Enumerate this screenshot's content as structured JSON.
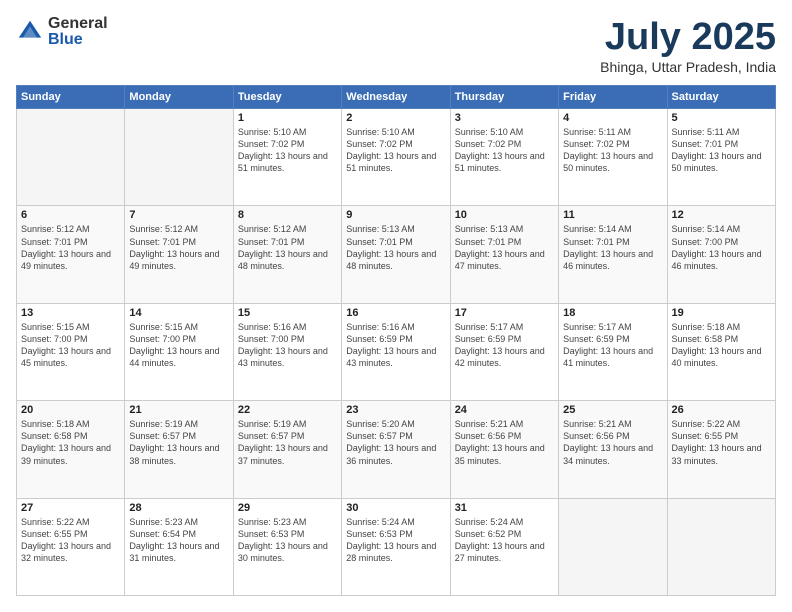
{
  "header": {
    "logo_general": "General",
    "logo_blue": "Blue",
    "month_title": "July 2025",
    "location": "Bhinga, Uttar Pradesh, India"
  },
  "days_of_week": [
    "Sunday",
    "Monday",
    "Tuesday",
    "Wednesday",
    "Thursday",
    "Friday",
    "Saturday"
  ],
  "weeks": [
    [
      {
        "day": "",
        "empty": true
      },
      {
        "day": "",
        "empty": true
      },
      {
        "day": "1",
        "sunrise": "5:10 AM",
        "sunset": "7:02 PM",
        "daylight": "13 hours and 51 minutes."
      },
      {
        "day": "2",
        "sunrise": "5:10 AM",
        "sunset": "7:02 PM",
        "daylight": "13 hours and 51 minutes."
      },
      {
        "day": "3",
        "sunrise": "5:10 AM",
        "sunset": "7:02 PM",
        "daylight": "13 hours and 51 minutes."
      },
      {
        "day": "4",
        "sunrise": "5:11 AM",
        "sunset": "7:02 PM",
        "daylight": "13 hours and 50 minutes."
      },
      {
        "day": "5",
        "sunrise": "5:11 AM",
        "sunset": "7:01 PM",
        "daylight": "13 hours and 50 minutes."
      }
    ],
    [
      {
        "day": "6",
        "sunrise": "5:12 AM",
        "sunset": "7:01 PM",
        "daylight": "13 hours and 49 minutes."
      },
      {
        "day": "7",
        "sunrise": "5:12 AM",
        "sunset": "7:01 PM",
        "daylight": "13 hours and 49 minutes."
      },
      {
        "day": "8",
        "sunrise": "5:12 AM",
        "sunset": "7:01 PM",
        "daylight": "13 hours and 48 minutes."
      },
      {
        "day": "9",
        "sunrise": "5:13 AM",
        "sunset": "7:01 PM",
        "daylight": "13 hours and 48 minutes."
      },
      {
        "day": "10",
        "sunrise": "5:13 AM",
        "sunset": "7:01 PM",
        "daylight": "13 hours and 47 minutes."
      },
      {
        "day": "11",
        "sunrise": "5:14 AM",
        "sunset": "7:01 PM",
        "daylight": "13 hours and 46 minutes."
      },
      {
        "day": "12",
        "sunrise": "5:14 AM",
        "sunset": "7:00 PM",
        "daylight": "13 hours and 46 minutes."
      }
    ],
    [
      {
        "day": "13",
        "sunrise": "5:15 AM",
        "sunset": "7:00 PM",
        "daylight": "13 hours and 45 minutes."
      },
      {
        "day": "14",
        "sunrise": "5:15 AM",
        "sunset": "7:00 PM",
        "daylight": "13 hours and 44 minutes."
      },
      {
        "day": "15",
        "sunrise": "5:16 AM",
        "sunset": "7:00 PM",
        "daylight": "13 hours and 43 minutes."
      },
      {
        "day": "16",
        "sunrise": "5:16 AM",
        "sunset": "6:59 PM",
        "daylight": "13 hours and 43 minutes."
      },
      {
        "day": "17",
        "sunrise": "5:17 AM",
        "sunset": "6:59 PM",
        "daylight": "13 hours and 42 minutes."
      },
      {
        "day": "18",
        "sunrise": "5:17 AM",
        "sunset": "6:59 PM",
        "daylight": "13 hours and 41 minutes."
      },
      {
        "day": "19",
        "sunrise": "5:18 AM",
        "sunset": "6:58 PM",
        "daylight": "13 hours and 40 minutes."
      }
    ],
    [
      {
        "day": "20",
        "sunrise": "5:18 AM",
        "sunset": "6:58 PM",
        "daylight": "13 hours and 39 minutes."
      },
      {
        "day": "21",
        "sunrise": "5:19 AM",
        "sunset": "6:57 PM",
        "daylight": "13 hours and 38 minutes."
      },
      {
        "day": "22",
        "sunrise": "5:19 AM",
        "sunset": "6:57 PM",
        "daylight": "13 hours and 37 minutes."
      },
      {
        "day": "23",
        "sunrise": "5:20 AM",
        "sunset": "6:57 PM",
        "daylight": "13 hours and 36 minutes."
      },
      {
        "day": "24",
        "sunrise": "5:21 AM",
        "sunset": "6:56 PM",
        "daylight": "13 hours and 35 minutes."
      },
      {
        "day": "25",
        "sunrise": "5:21 AM",
        "sunset": "6:56 PM",
        "daylight": "13 hours and 34 minutes."
      },
      {
        "day": "26",
        "sunrise": "5:22 AM",
        "sunset": "6:55 PM",
        "daylight": "13 hours and 33 minutes."
      }
    ],
    [
      {
        "day": "27",
        "sunrise": "5:22 AM",
        "sunset": "6:55 PM",
        "daylight": "13 hours and 32 minutes."
      },
      {
        "day": "28",
        "sunrise": "5:23 AM",
        "sunset": "6:54 PM",
        "daylight": "13 hours and 31 minutes."
      },
      {
        "day": "29",
        "sunrise": "5:23 AM",
        "sunset": "6:53 PM",
        "daylight": "13 hours and 30 minutes."
      },
      {
        "day": "30",
        "sunrise": "5:24 AM",
        "sunset": "6:53 PM",
        "daylight": "13 hours and 28 minutes."
      },
      {
        "day": "31",
        "sunrise": "5:24 AM",
        "sunset": "6:52 PM",
        "daylight": "13 hours and 27 minutes."
      },
      {
        "day": "",
        "empty": true
      },
      {
        "day": "",
        "empty": true
      }
    ]
  ]
}
